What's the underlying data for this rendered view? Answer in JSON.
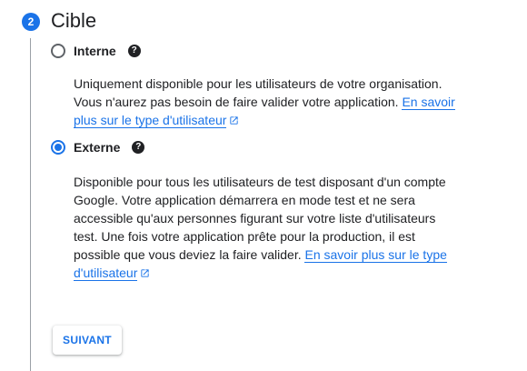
{
  "step": {
    "number": "2",
    "title": "Cible"
  },
  "options": [
    {
      "label": "Interne",
      "selected": false,
      "help_icon": "?",
      "description_lines": [
        "Uniquement disponible pour les utilisateurs de votre organisation.",
        "Vous n'aurez pas besoin de faire valider votre application."
      ],
      "link_text_part1": "En savoir",
      "link_text_part2": "plus sur le type d'utilisateur",
      "link_icon": "open-in-new-icon"
    },
    {
      "label": "Externe",
      "selected": true,
      "help_icon": "?",
      "description_lines": [
        "Disponible pour tous les utilisateurs de test disposant d'un compte",
        "Google. Votre application démarrera en mode test et ne sera",
        "accessible qu'aux personnes figurant sur votre liste d'utilisateurs",
        "test. Une fois votre application prête pour la production, il est",
        "possible que vous deviez la faire valider."
      ],
      "link_text_part1": "En savoir plus sur le type",
      "link_text_part2": "d'utilisateur",
      "link_icon": "open-in-new-icon"
    }
  ],
  "next_button": {
    "label": "SUIVANT"
  },
  "colors": {
    "accent": "#1a73e8",
    "text": "#202124",
    "rail": "#9aa0a6"
  }
}
